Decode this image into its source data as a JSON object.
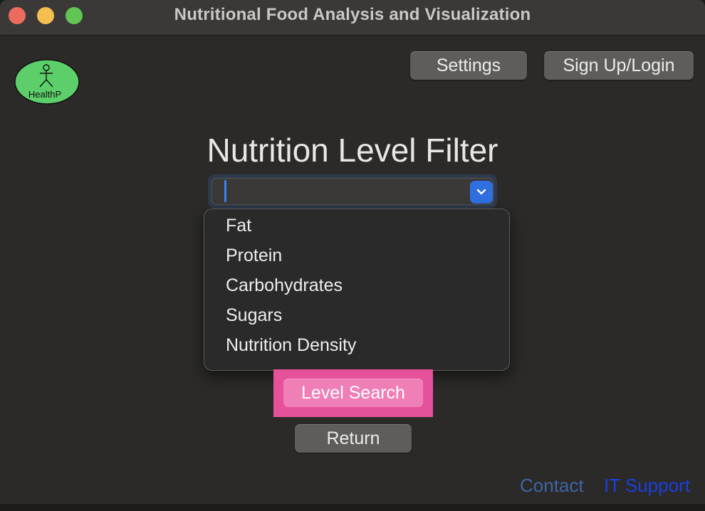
{
  "window": {
    "title": "Nutritional Food Analysis and Visualization"
  },
  "logo": {
    "text": "HealthP",
    "icon": "stick-figure-icon"
  },
  "header": {
    "settings_label": "Settings",
    "signup_label": "Sign Up/Login"
  },
  "main": {
    "heading": "Nutrition Level Filter",
    "combo_value": "",
    "dropdown_items": [
      "Fat",
      "Protein",
      "Carbohydrates",
      "Sugars",
      "Nutrition Density"
    ],
    "level_search_label": "Level Search",
    "return_label": "Return"
  },
  "footer": {
    "contact_label": "Contact",
    "it_support_label": "IT Support"
  },
  "colors": {
    "accent": "#2f6fe0",
    "highlight": "#e6519b",
    "logo_green": "#5ccf6a"
  }
}
